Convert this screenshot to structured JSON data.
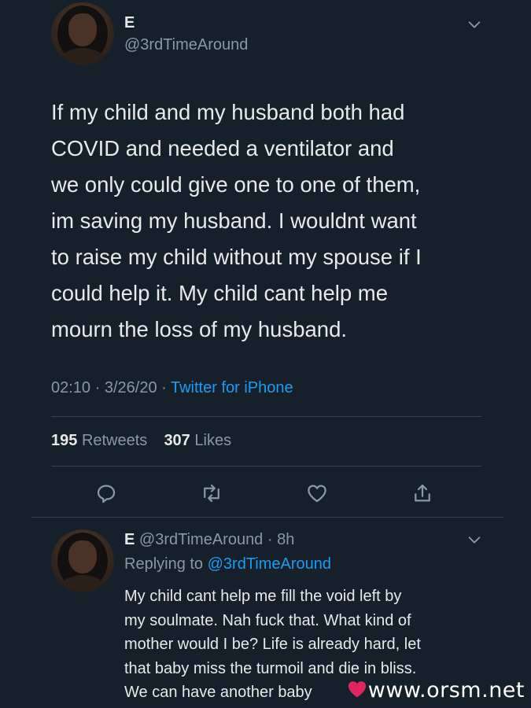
{
  "tweet": {
    "author_name": "E",
    "author_handle": "@3rdTimeAround",
    "text": "If my child and my husband both had\nCOVID and needed a ventilator and\nwe only could give one to one of them,\nim saving my husband. I wouldnt want\nto raise my child without my spouse if I\ncould help it. My child cant help me\nmourn the loss of my husband.",
    "time": "02:10",
    "date": "3/26/20",
    "source": "Twitter for iPhone",
    "retweets_count": "195",
    "retweets_label": "Retweets",
    "likes_count": "307",
    "likes_label": "Likes"
  },
  "reply": {
    "author_name": "E",
    "author_handle": "@3rdTimeAround",
    "age": "8h",
    "replying_prefix": "Replying to",
    "replying_handle": "@3rdTimeAround",
    "text": "My child cant help me fill the void left by\nmy soulmate. Nah fuck that. What kind of\nmother would I be? Life is already hard, let\nthat baby miss the turmoil and die in bliss.\nWe can have another baby"
  },
  "watermark": "www.orsm.net",
  "colors": {
    "background": "#15202b",
    "text": "#e7e9ea",
    "muted": "#8899a6",
    "link": "#1d9bf0",
    "divider": "#38444d"
  },
  "icons": [
    "chevron-down-icon",
    "reply-icon",
    "retweet-icon",
    "like-icon",
    "share-icon",
    "heart-emoji-icon"
  ]
}
